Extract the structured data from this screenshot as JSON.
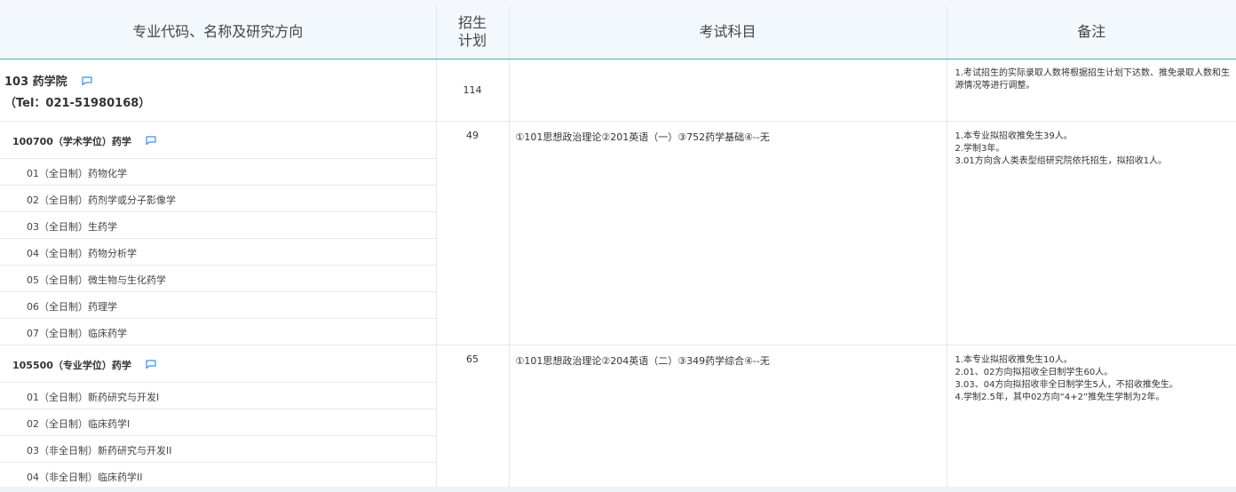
{
  "header": {
    "col_major": "专业代码、名称及研究方向",
    "col_quota_line1": "招生",
    "col_quota_line2": "计划",
    "col_subjects": "考试科目",
    "col_notes": "备注"
  },
  "college": {
    "name": "103 药学院",
    "tel": "（Tel：021-51980168）",
    "quota": "114",
    "note": "1.考试招生的实际录取人数将根据招生计划下达数、推免录取人数和生源情况等进行调整。"
  },
  "majors": [
    {
      "title": "100700（学术学位）药学",
      "quota": "49",
      "subjects": "①101思想政治理论②201英语（一）③752药学基础④--无",
      "notes": [
        "1.本专业拟招收推免生39人。",
        "2.学制3年。",
        "3.01方向含人类表型组研究院依托招生，拟招收1人。"
      ],
      "directions": [
        "01（全日制）药物化学",
        "02（全日制）药剂学或分子影像学",
        "03（全日制）生药学",
        "04（全日制）药物分析学",
        "05（全日制）微生物与生化药学",
        "06（全日制）药理学",
        "07（全日制）临床药学"
      ]
    },
    {
      "title": "105500（专业学位）药学",
      "quota": "65",
      "subjects": "①101思想政治理论②204英语（二）③349药学综合④--无",
      "notes": [
        "1.本专业拟招收推免生10人。",
        "2.01、02方向拟招收全日制学生60人。",
        "3.03、04方向拟招收非全日制学生5人，不招收推免生。",
        "4.学制2.5年，其中02方向“4+2”推免生学制为2年。"
      ],
      "directions": [
        "01（全日制）新药研究与开发I",
        "02（全日制）临床药学I",
        "03（非全日制）新药研究与开发II",
        "04（非全日制）临床药学II"
      ]
    }
  ],
  "colors": {
    "header_bg": "#f3f8fc",
    "header_border": "#4aa9b1",
    "icon": "#3d8fe6"
  },
  "icons": {
    "comment": "comment-icon"
  }
}
